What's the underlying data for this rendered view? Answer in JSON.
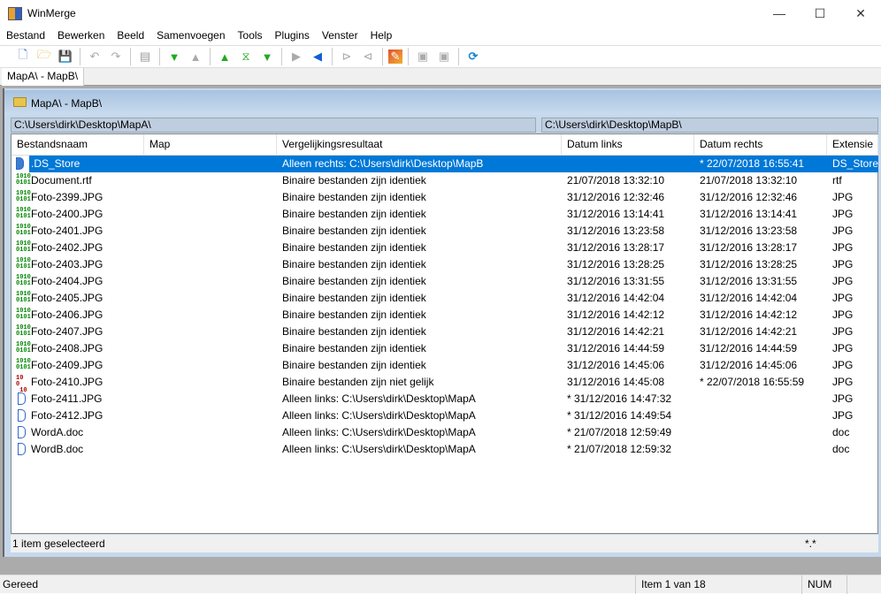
{
  "app": {
    "title": "WinMerge"
  },
  "menu": [
    "Bestand",
    "Bewerken",
    "Beeld",
    "Samenvoegen",
    "Tools",
    "Plugins",
    "Venster",
    "Help"
  ],
  "tab": {
    "label": "MapA\\ - MapB\\"
  },
  "child": {
    "title": "MapA\\ - MapB\\",
    "left_path": "C:\\Users\\dirk\\Desktop\\MapA\\",
    "right_path": "C:\\Users\\dirk\\Desktop\\MapB\\"
  },
  "columns": [
    "Bestandsnaam",
    "Map",
    "Vergelijkingsresultaat",
    "Datum links",
    "Datum rechts",
    "Extensie"
  ],
  "rows": [
    {
      "icon": "right-only",
      "name": ".DS_Store",
      "map": "",
      "result": "Alleen rechts: C:\\Users\\dirk\\Desktop\\MapB",
      "left": "",
      "right": "* 22/07/2018 16:55:41",
      "ext": "DS_Store",
      "selected": true
    },
    {
      "icon": "binary-identical",
      "name": "Document.rtf",
      "map": "",
      "result": "Binaire bestanden zijn identiek",
      "left": "21/07/2018 13:32:10",
      "right": "21/07/2018 13:32:10",
      "ext": "rtf"
    },
    {
      "icon": "binary-identical",
      "name": "Foto-2399.JPG",
      "map": "",
      "result": "Binaire bestanden zijn identiek",
      "left": "31/12/2016 12:32:46",
      "right": "31/12/2016 12:32:46",
      "ext": "JPG"
    },
    {
      "icon": "binary-identical",
      "name": "Foto-2400.JPG",
      "map": "",
      "result": "Binaire bestanden zijn identiek",
      "left": "31/12/2016 13:14:41",
      "right": "31/12/2016 13:14:41",
      "ext": "JPG"
    },
    {
      "icon": "binary-identical",
      "name": "Foto-2401.JPG",
      "map": "",
      "result": "Binaire bestanden zijn identiek",
      "left": "31/12/2016 13:23:58",
      "right": "31/12/2016 13:23:58",
      "ext": "JPG"
    },
    {
      "icon": "binary-identical",
      "name": "Foto-2402.JPG",
      "map": "",
      "result": "Binaire bestanden zijn identiek",
      "left": "31/12/2016 13:28:17",
      "right": "31/12/2016 13:28:17",
      "ext": "JPG"
    },
    {
      "icon": "binary-identical",
      "name": "Foto-2403.JPG",
      "map": "",
      "result": "Binaire bestanden zijn identiek",
      "left": "31/12/2016 13:28:25",
      "right": "31/12/2016 13:28:25",
      "ext": "JPG"
    },
    {
      "icon": "binary-identical",
      "name": "Foto-2404.JPG",
      "map": "",
      "result": "Binaire bestanden zijn identiek",
      "left": "31/12/2016 13:31:55",
      "right": "31/12/2016 13:31:55",
      "ext": "JPG"
    },
    {
      "icon": "binary-identical",
      "name": "Foto-2405.JPG",
      "map": "",
      "result": "Binaire bestanden zijn identiek",
      "left": "31/12/2016 14:42:04",
      "right": "31/12/2016 14:42:04",
      "ext": "JPG"
    },
    {
      "icon": "binary-identical",
      "name": "Foto-2406.JPG",
      "map": "",
      "result": "Binaire bestanden zijn identiek",
      "left": "31/12/2016 14:42:12",
      "right": "31/12/2016 14:42:12",
      "ext": "JPG"
    },
    {
      "icon": "binary-identical",
      "name": "Foto-2407.JPG",
      "map": "",
      "result": "Binaire bestanden zijn identiek",
      "left": "31/12/2016 14:42:21",
      "right": "31/12/2016 14:42:21",
      "ext": "JPG"
    },
    {
      "icon": "binary-identical",
      "name": "Foto-2408.JPG",
      "map": "",
      "result": "Binaire bestanden zijn identiek",
      "left": "31/12/2016 14:44:59",
      "right": "31/12/2016 14:44:59",
      "ext": "JPG"
    },
    {
      "icon": "binary-identical",
      "name": "Foto-2409.JPG",
      "map": "",
      "result": "Binaire bestanden zijn identiek",
      "left": "31/12/2016 14:45:06",
      "right": "31/12/2016 14:45:06",
      "ext": "JPG"
    },
    {
      "icon": "binary-different",
      "name": "Foto-2410.JPG",
      "map": "",
      "result": "Binaire bestanden zijn niet gelijk",
      "left": "31/12/2016 14:45:08",
      "right": "* 22/07/2018 16:55:59",
      "ext": "JPG"
    },
    {
      "icon": "left-only",
      "name": "Foto-2411.JPG",
      "map": "",
      "result": "Alleen links: C:\\Users\\dirk\\Desktop\\MapA",
      "left": "* 31/12/2016 14:47:32",
      "right": "",
      "ext": "JPG"
    },
    {
      "icon": "left-only",
      "name": "Foto-2412.JPG",
      "map": "",
      "result": "Alleen links: C:\\Users\\dirk\\Desktop\\MapA",
      "left": "* 31/12/2016 14:49:54",
      "right": "",
      "ext": "JPG"
    },
    {
      "icon": "left-only",
      "name": "WordA.doc",
      "map": "",
      "result": "Alleen links: C:\\Users\\dirk\\Desktop\\MapA",
      "left": "* 21/07/2018 12:59:49",
      "right": "",
      "ext": "doc"
    },
    {
      "icon": "left-only",
      "name": "WordB.doc",
      "map": "",
      "result": "Alleen links: C:\\Users\\dirk\\Desktop\\MapA",
      "left": "* 21/07/2018 12:59:32",
      "right": "",
      "ext": "doc"
    }
  ],
  "selection_status": {
    "text": "1 item geselecteerd",
    "filter": "*.*"
  },
  "statusbar": {
    "text": "Gereed",
    "item": "Item 1 van 18",
    "num": "NUM"
  },
  "colors": {
    "selection": "#0078d7",
    "identical": "#008800",
    "different": "#aa0000"
  }
}
